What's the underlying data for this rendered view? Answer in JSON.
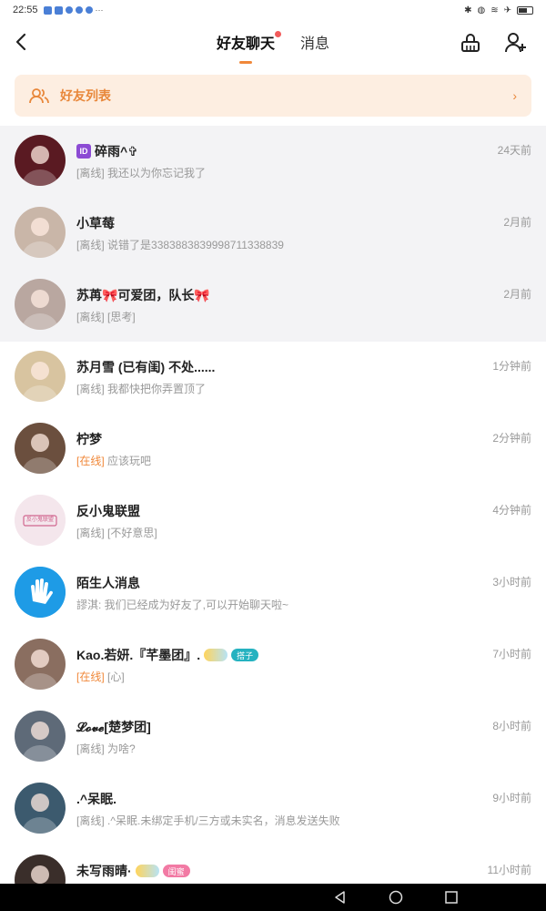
{
  "status_bar": {
    "time": "22:55",
    "more": "···"
  },
  "header": {
    "tabs": [
      {
        "label": "好友聊天",
        "active": true,
        "has_dot": true
      },
      {
        "label": "消息",
        "active": false
      }
    ]
  },
  "banner": {
    "label": "好友列表"
  },
  "chats": [
    {
      "name": "碎雨^✞",
      "time": "24天前",
      "status": "[离线]",
      "message": "我还以为你忘记我了",
      "avatar_color": "#5a1a22",
      "pinned": true,
      "badge": "ID"
    },
    {
      "name": "小草莓",
      "time": "2月前",
      "status": "[离线]",
      "message": "说错了是3383883839998711338839",
      "avatar_color": "#c9b6a8",
      "pinned": true
    },
    {
      "name": "苏苒🎀可爱团，队长🎀",
      "time": "2月前",
      "status": "[离线]",
      "message": "[思考]",
      "avatar_color": "#b9a7a0",
      "pinned": true
    },
    {
      "name": "苏月雪 (已有闺) 不处......",
      "time": "1分钟前",
      "status": "[离线]",
      "message": "我都快把你弄置顶了",
      "avatar_color": "#d8c4a0"
    },
    {
      "name": "柠梦",
      "time": "2分钟前",
      "status": "[在线]",
      "message": "应该玩吧",
      "avatar_color": "#6b4f3e",
      "online": true
    },
    {
      "name": "反小鬼联盟",
      "time": "4分钟前",
      "status": "[离线]",
      "message": "[不好意思]",
      "avatar_color": "#f4e6ec",
      "logo_text": "反小鬼联盟"
    },
    {
      "name": "陌生人消息",
      "time": "3小时前",
      "status": "",
      "message": "謬淇: 我们已经成为好友了,可以开始聊天啦~",
      "avatar_color": "#1e9be6"
    },
    {
      "name": "Kao.若妍.『芊墨团』.",
      "time": "7小时前",
      "status": "[在线]",
      "message": "[心]",
      "avatar_color": "#8a6e60",
      "online": true,
      "tag": "搭子"
    },
    {
      "name": "𝓛𝓸𝓿𝓮[楚梦团]",
      "time": "8小时前",
      "status": "[离线]",
      "message": "为啥?",
      "avatar_color": "#5e6a78"
    },
    {
      "name": ".^呆眠.",
      "time": "9小时前",
      "status": "[离线]",
      "message": ".^呆眠.未绑定手机/三方或未实名，消息发送失败",
      "avatar_color": "#3c5a6e"
    },
    {
      "name": "未写雨晴·",
      "time": "11小时前",
      "status": "",
      "message": "",
      "avatar_color": "#3a2e2a",
      "tag": "闺蜜",
      "tag_style": "pink"
    }
  ],
  "colors": {
    "accent": "#f0883a",
    "banner_bg": "#fdeee1",
    "pinned_bg": "#f3f3f5"
  }
}
